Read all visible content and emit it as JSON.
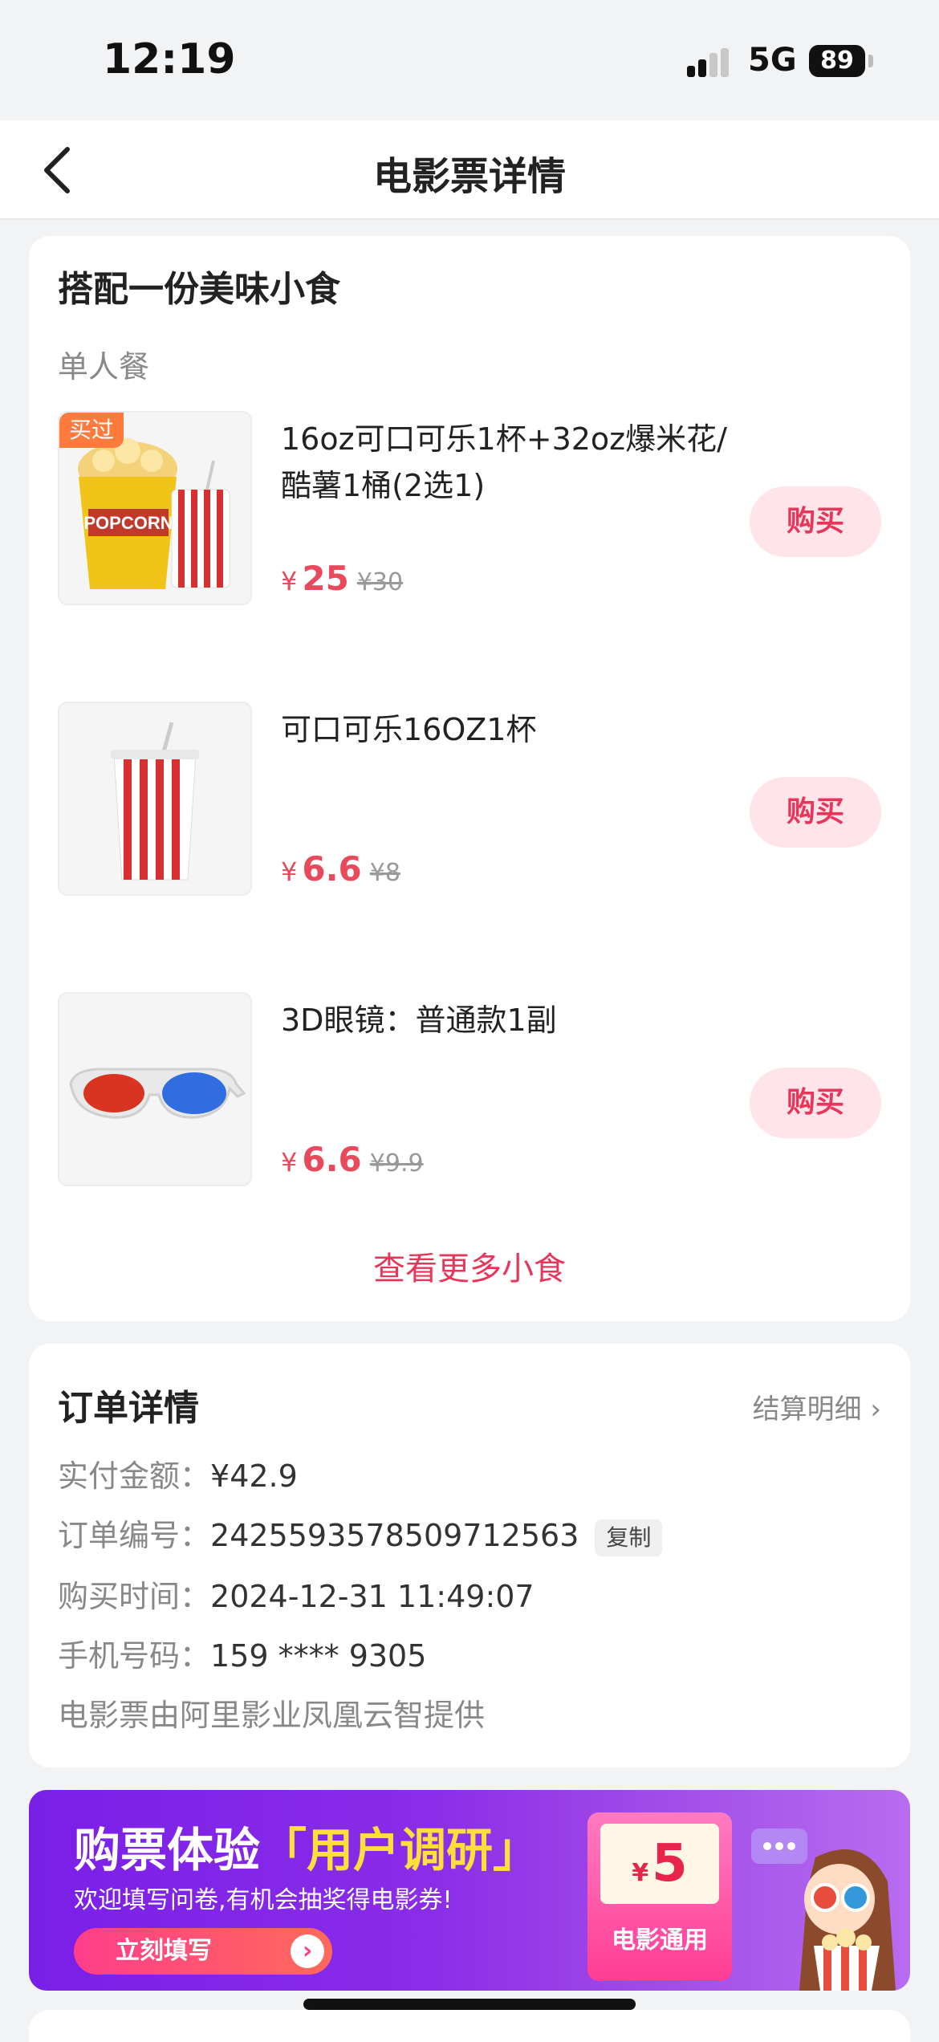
{
  "status_bar": {
    "time": "12:19",
    "network": "5G",
    "battery": "89"
  },
  "nav": {
    "title": "电影票详情"
  },
  "snacks": {
    "title": "搭配一份美味小食",
    "section_label": "单人餐",
    "items": [
      {
        "name": "16oz可口可乐1杯+32oz爆米花/酷薯1桶(2选1)",
        "price": "25",
        "original_price": "¥30",
        "badge": "买过",
        "buy_label": "购买",
        "image_icon": "popcorn-cola-icon"
      },
      {
        "name": "可口可乐16OZ1杯",
        "price": "6.6",
        "original_price": "¥8",
        "buy_label": "购买",
        "image_icon": "cola-cup-icon"
      },
      {
        "name": "3D眼镜：普通款1副",
        "price": "6.6",
        "original_price": "¥9.9",
        "buy_label": "购买",
        "image_icon": "3d-glasses-icon"
      }
    ],
    "currency": "¥",
    "more_label": "查看更多小食"
  },
  "order": {
    "title": "订单详情",
    "settle_label": "结算明细 ›",
    "paid_key": "实付金额：",
    "paid_value": "¥42.9",
    "number_key": "订单编号：",
    "number_value": "2425593578509712563",
    "copy_label": "复制",
    "time_key": "购买时间：",
    "time_value": "2024-12-31 11:49:07",
    "phone_key": "手机号码：",
    "phone_value": "159 **** 9305",
    "provider": "电影票由阿里影业凤凰云智提供"
  },
  "banner": {
    "title_plain": "购票体验",
    "title_highlight": "「用户调研」",
    "subtitle": "欢迎填写问卷,有机会抽奖得电影券!",
    "button_label": "立刻填写",
    "voucher_currency": "¥",
    "voucher_amount": "5",
    "voucher_label": "电影通用"
  },
  "colors": {
    "accent": "#e8355a",
    "price": "#e94a5b",
    "banner": "#8a2ce8"
  }
}
